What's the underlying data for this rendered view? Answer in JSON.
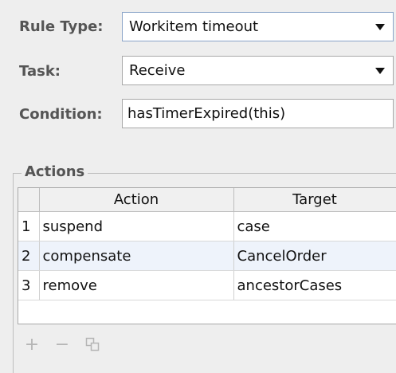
{
  "rule_type": {
    "label": "Rule Type:",
    "value": "Workitem timeout"
  },
  "task": {
    "label": "Task:",
    "value": "Receive"
  },
  "condition": {
    "label": "Condition:",
    "value": "hasTimerExpired(this)"
  },
  "actions": {
    "legend": "Actions",
    "columns": [
      "",
      "Action",
      "Target"
    ],
    "rows": [
      {
        "num": "1",
        "action": "suspend",
        "target": "case"
      },
      {
        "num": "2",
        "action": "compensate",
        "target": "CancelOrder"
      },
      {
        "num": "3",
        "action": "remove",
        "target": "ancestorCases"
      }
    ]
  },
  "toolbar": {
    "add_glyph": "+",
    "remove_glyph": "−",
    "add_icon": "plus-icon",
    "remove_icon": "minus-icon",
    "duplicate_icon": "duplicate-icon"
  }
}
